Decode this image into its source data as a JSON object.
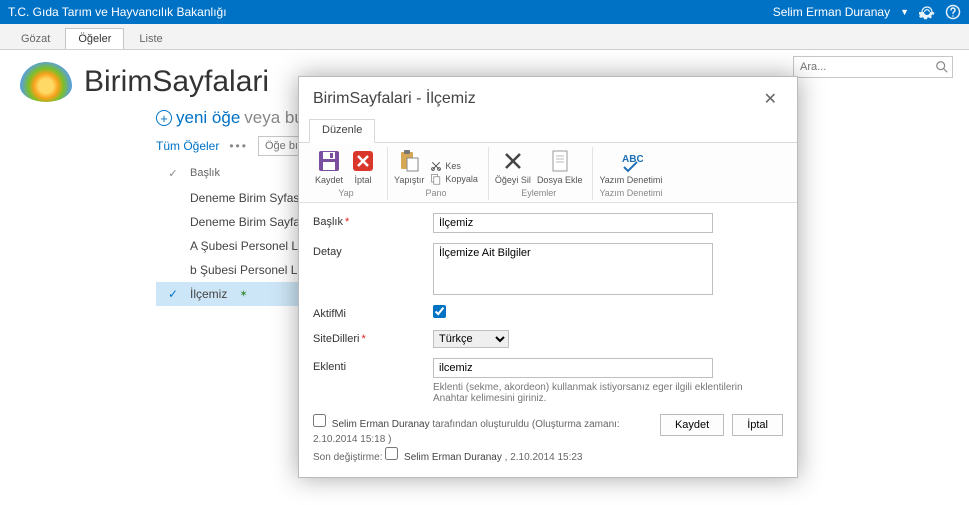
{
  "topbar": {
    "title": "T.C. Gıda Tarım ve Hayvancılık Bakanlığı",
    "user": "Selim Erman Duranay"
  },
  "ribbon": {
    "tabs": [
      "Gözat",
      "Öğeler",
      "Liste"
    ],
    "active_index": 1
  },
  "page": {
    "title": "BirimSayfalari"
  },
  "search": {
    "placeholder": "Ara..."
  },
  "newitem": {
    "link": "yeni öğe",
    "rest": "veya bu"
  },
  "viewbar": {
    "allitems": "Tüm Öğeler",
    "find_placeholder": "Öğe bı"
  },
  "listcol": {
    "header": "Başlık",
    "rows": [
      {
        "label": "Deneme Birim Syfası"
      },
      {
        "label": "Deneme Birim Sayfası İ"
      },
      {
        "label": "A Şubesi Personel Listes"
      },
      {
        "label": "b Şubesi Personel Listes"
      },
      {
        "label": "İlçemiz",
        "selected": true,
        "new": true
      }
    ]
  },
  "dialog": {
    "title": "BirimSayfalari - İlçemiz",
    "tab": "Düzenle",
    "ribbon": {
      "groups": [
        {
          "name": "Yap",
          "items": [
            "Kaydet",
            "İptal"
          ]
        },
        {
          "name": "Pano",
          "items": [
            "Yapıştır",
            "Kes",
            "Kopyala"
          ]
        },
        {
          "name": "Eylemler",
          "items": [
            "Öğeyi Sil",
            "Dosya Ekle"
          ]
        },
        {
          "name": "Yazım Denetimi",
          "items": [
            "Yazım Denetimi"
          ]
        }
      ]
    },
    "form": {
      "baslik_label": "Başlık",
      "baslik_value": "İlçemiz",
      "detay_label": "Detay",
      "detay_value": "İlçemize Ait Bilgiler",
      "aktif_label": "AktifMi",
      "aktif_checked": true,
      "sitedilleri_label": "SiteDilleri",
      "sitedilleri_value": "Türkçe",
      "eklenti_label": "Eklenti",
      "eklenti_value": "ilcemiz",
      "eklenti_help": "Eklenti (sekme, akordeon) kullanmak istiyorsanız eger ilgili eklentilerin Anahtar kelimesini giriniz."
    },
    "audit": {
      "created_by": "Selim Erman Duranay",
      "created_text": "tarafından oluşturuldu (Oluşturma zamanı: 2.10.2014 15:18  )",
      "modified_label": "Son değiştirme:",
      "modified_by": "Selim Erman Duranay",
      "modified_at": ", 2.10.2014 15:23"
    },
    "buttons": {
      "save": "Kaydet",
      "cancel": "İptal"
    }
  }
}
